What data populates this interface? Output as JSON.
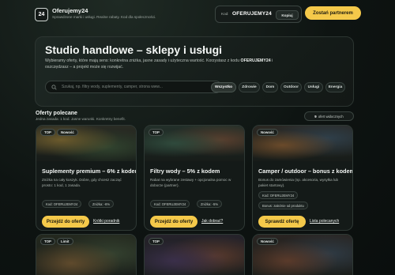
{
  "header": {
    "logo": "24",
    "title": "Oferujemy24",
    "subtitle": "Sprawdzone marki i usługi. Realne rabaty. Kod dla społeczności.",
    "code_label": "Kod:",
    "code_value": "OFERUJEMY24",
    "copy_label": "Kopiuj",
    "partner_label": "Zostań partnerem"
  },
  "hero": {
    "title": "Studio handlowe – sklepy i usługi",
    "desc_1": "Wybieramy oferty, które mają sens: konkretna zniżka, jasne zasady i użyteczna wartość. Korzystasz z kodu",
    "desc_code": "OFERUJEMY24",
    "desc_2": "i oszczędzasz – a projekt może się rozwijać.",
    "search_placeholder": "Szukaj, np. filtry wody, suplementy, camper, strona www...",
    "chips": [
      "Wszystko",
      "Zdrowie",
      "Dom",
      "Outdoor",
      "Usługi",
      "Energia"
    ]
  },
  "section": {
    "title": "Oferty polecane",
    "subtitle": "Jedna zasada: 1 kod. Jasne warunki. Konkretny benefit.",
    "count": "9",
    "count_label": "ofert widocznych"
  },
  "cards": [
    {
      "badges": [
        "TOP",
        "Nowość"
      ],
      "title": "Suplementy premium – 6% z kodem",
      "desc": "Zniżka na cały koszyk. Dobre, gdy chcesz zacząć prosto: 1 kod, 1 zasada.",
      "tags": [
        "Kod: OFERUJEMY24",
        "Zniżka: -6%"
      ],
      "button": "Przejdź do oferty",
      "link": "Krótki poradnik"
    },
    {
      "badges": [
        "TOP"
      ],
      "title": "Filtry wody – 5% z kodem",
      "desc": "Rabat na wybrane zestawy + opcjonalna pomoc w doborze (partner).",
      "tags": [
        "Kod: OFERUJEMY24",
        "Zniżka: -5%"
      ],
      "button": "Przejdź do oferty",
      "link": "Jak dobrać?"
    },
    {
      "badges": [
        "Nowość"
      ],
      "title": "Camper / outdoor – bonus z kodem",
      "desc": "Bonus do zamówienia (np. akcesoria, wysyłka lub pakiet startowy).",
      "tags": [
        "Kod: OFERUJEMY24",
        "Bonus: zależnie od produktu"
      ],
      "button": "Sprawdź ofertę",
      "link": "Lista polecanych"
    },
    {
      "badges": [
        "TOP",
        "Limit"
      ]
    },
    {
      "badges": [
        "TOP"
      ]
    },
    {
      "badges": [
        "Nowość"
      ]
    }
  ],
  "colors": {
    "accent": "#f5c94a",
    "background": "#0e1412"
  }
}
